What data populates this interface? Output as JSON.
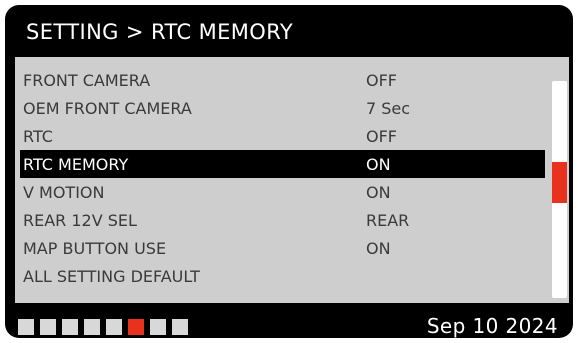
{
  "header": {
    "title": "SETTING > RTC MEMORY"
  },
  "menu": {
    "items": [
      {
        "label": "FRONT CAMERA",
        "value": "OFF",
        "selected": false
      },
      {
        "label": "OEM FRONT CAMERA",
        "value": "7 Sec",
        "selected": false
      },
      {
        "label": "RTC",
        "value": "OFF",
        "selected": false
      },
      {
        "label": "RTC MEMORY",
        "value": "ON",
        "selected": true
      },
      {
        "label": "V MOTION",
        "value": "ON",
        "selected": false
      },
      {
        "label": "REAR 12V SEL",
        "value": "REAR",
        "selected": false
      },
      {
        "label": "MAP BUTTON USE",
        "value": "ON",
        "selected": false
      },
      {
        "label": "ALL SETTING DEFAULT",
        "value": "",
        "selected": false
      }
    ],
    "scroll_position_fraction": 0.5
  },
  "footer": {
    "page_count": 8,
    "active_page": 6,
    "date": "Sep 10 2024"
  },
  "colors": {
    "background": "#000000",
    "panel": "#cecece",
    "accent": "#e8321e",
    "selected_row": "#000000",
    "text_light": "#ffffff",
    "text_dark": "#3a3a3a"
  }
}
